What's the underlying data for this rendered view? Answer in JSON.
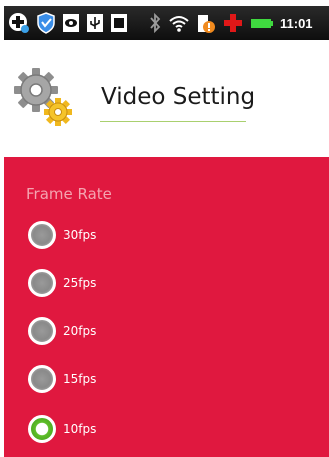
{
  "status_bar": {
    "time": "11:01",
    "icons": [
      "add-icon",
      "shield-icon",
      "eye-icon",
      "usb-icon",
      "download-icon",
      "bluetooth-icon",
      "wifi-icon",
      "alert-icon",
      "cross-icon",
      "battery-icon"
    ]
  },
  "header": {
    "title": "Video Setting",
    "icon": "gear-icon"
  },
  "colors": {
    "panel_background": "#e0183f",
    "section_label": "#f4a4b0",
    "selected_radio": "#5fbf2a",
    "title_underline": "#a9d06f"
  },
  "frame_rate": {
    "label": "Frame Rate",
    "options": [
      {
        "label": "30fps",
        "selected": false
      },
      {
        "label": "25fps",
        "selected": false
      },
      {
        "label": "20fps",
        "selected": false
      },
      {
        "label": "15fps",
        "selected": false
      },
      {
        "label": "10fps",
        "selected": true
      }
    ]
  }
}
